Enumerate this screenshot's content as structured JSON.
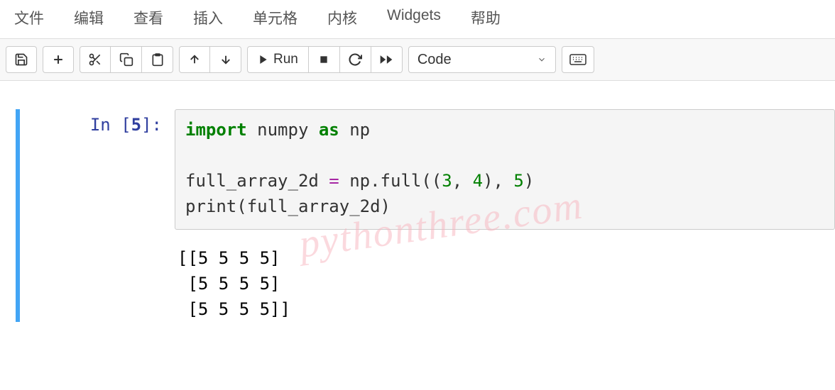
{
  "menu": {
    "file": "文件",
    "edit": "编辑",
    "view": "查看",
    "insert": "插入",
    "cell": "单元格",
    "kernel": "内核",
    "widgets": "Widgets",
    "help": "帮助"
  },
  "toolbar": {
    "run_label": "Run",
    "celltype_selected": "Code"
  },
  "cell": {
    "prompt_label": "In ",
    "prompt_number": "5",
    "code": {
      "line1_kw1": "import",
      "line1_mod": " numpy ",
      "line1_kw2": "as",
      "line1_alias": " np",
      "line3_var": "full_array_2d ",
      "line3_eq": "=",
      "line3_call": " np.full((",
      "line3_n1": "3",
      "line3_c1": ", ",
      "line3_n2": "4",
      "line3_c2": "), ",
      "line3_n3": "5",
      "line3_c3": ")",
      "line4_fn": "print",
      "line4_rest": "(full_array_2d)"
    },
    "output": "[[5 5 5 5]\n [5 5 5 5]\n [5 5 5 5]]"
  },
  "watermark": "pythonthree.com"
}
